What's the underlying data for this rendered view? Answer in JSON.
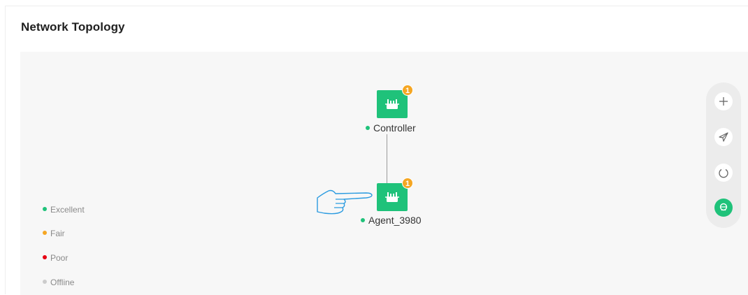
{
  "title": "Network Topology",
  "nodes": [
    {
      "label": "Controller",
      "badge": "1",
      "status_color": "#1fc27a"
    },
    {
      "label": "Agent_3980",
      "badge": "1",
      "status_color": "#1fc27a"
    }
  ],
  "legend": [
    {
      "label": "Excellent",
      "color": "#1fc27a"
    },
    {
      "label": "Fair",
      "color": "#f5a623"
    },
    {
      "label": "Poor",
      "color": "#e60012"
    },
    {
      "label": "Offline",
      "color": "#cccccc"
    }
  ],
  "toolbar": [
    {
      "icon": "plus-icon"
    },
    {
      "icon": "send-icon"
    },
    {
      "icon": "power-icon"
    },
    {
      "icon": "router-icon",
      "active": true
    }
  ],
  "colors": {
    "accent": "#1fc27a",
    "badge": "#f5a623",
    "canvas_bg": "#f7f7f7"
  }
}
